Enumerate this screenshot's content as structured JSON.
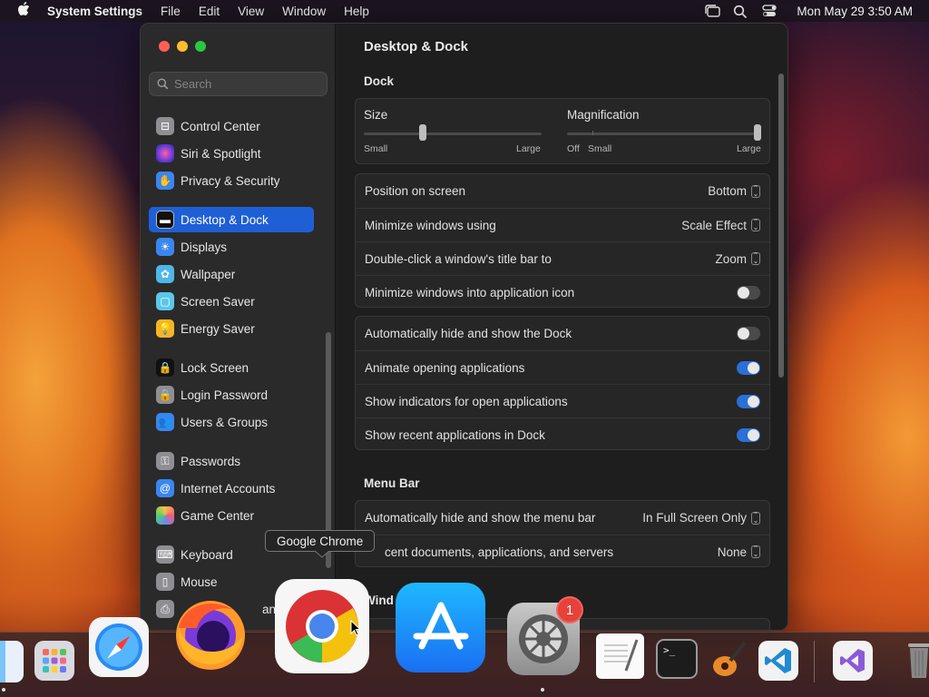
{
  "menubar": {
    "app_name": "System Settings",
    "menus": [
      "File",
      "Edit",
      "View",
      "Window",
      "Help"
    ],
    "clock": "Mon May 29  3:50 AM"
  },
  "window": {
    "title": "Desktop & Dock",
    "search_placeholder": "Search"
  },
  "sidebar": {
    "items": [
      {
        "label": "Control Center",
        "icon": "control-center-icon",
        "color": "#8e8e93"
      },
      {
        "label": "Siri & Spotlight",
        "icon": "siri-icon",
        "color": "#b03ad8"
      },
      {
        "label": "Privacy & Security",
        "icon": "hand-icon",
        "color": "#3a86f0"
      },
      {
        "label": "Desktop & Dock",
        "icon": "dock-icon",
        "color": "#1a1a1a"
      },
      {
        "label": "Displays",
        "icon": "sun-icon",
        "color": "#3a86f0"
      },
      {
        "label": "Wallpaper",
        "icon": "flower-icon",
        "color": "#4fb6e8"
      },
      {
        "label": "Screen Saver",
        "icon": "screen-saver-icon",
        "color": "#5ac8e8"
      },
      {
        "label": "Energy Saver",
        "icon": "bulb-icon",
        "color": "#f5b524"
      },
      {
        "label": "Lock Screen",
        "icon": "lock-icon",
        "color": "#1a1a1a"
      },
      {
        "label": "Login Password",
        "icon": "lock-icon",
        "color": "#8e8e93"
      },
      {
        "label": "Users & Groups",
        "icon": "users-icon",
        "color": "#3a86f0"
      },
      {
        "label": "Passwords",
        "icon": "key-icon",
        "color": "#8e8e93"
      },
      {
        "label": "Internet Accounts",
        "icon": "at-icon",
        "color": "#3a86f0"
      },
      {
        "label": "Game Center",
        "icon": "game-center-icon",
        "color": "#e8e8e8"
      },
      {
        "label": "Keyboard",
        "icon": "keyboard-icon",
        "color": "#8e8e93"
      },
      {
        "label": "Mouse",
        "icon": "mouse-icon",
        "color": "#8e8e93"
      },
      {
        "label": "anne",
        "icon": "printer-icon",
        "color": "#8e8e93"
      }
    ],
    "active_index": 3
  },
  "dock_section": {
    "title": "Dock",
    "size": {
      "label": "Size",
      "min_label": "Small",
      "max_label": "Large",
      "level": 0.33
    },
    "magnification": {
      "label": "Magnification",
      "off_label": "Off",
      "min_label": "Small",
      "max_label": "Large",
      "level": 1.0
    },
    "settings": [
      {
        "label": "Position on screen",
        "value": "Bottom"
      },
      {
        "label": "Minimize windows using",
        "value": "Scale Effect"
      },
      {
        "label": "Double-click a window's title bar to",
        "value": "Zoom"
      },
      {
        "label": "Minimize windows into application icon",
        "toggle": false
      }
    ],
    "toggles": [
      {
        "label": "Automatically hide and show the Dock",
        "on": false
      },
      {
        "label": "Animate opening applications",
        "on": true
      },
      {
        "label": "Show indicators for open applications",
        "on": true
      },
      {
        "label": "Show recent applications in Dock",
        "on": true
      }
    ]
  },
  "menu_bar_section": {
    "title": "Menu Bar",
    "rows": [
      {
        "label": "Automatically hide and show the menu bar",
        "value": "In Full Screen Only"
      },
      {
        "label": "cent documents, applications, and servers",
        "value": "None"
      }
    ]
  },
  "windows_section_title_partial": "Wind",
  "tooltip": "Google Chrome",
  "dock_apps": [
    {
      "name": "Finder",
      "icon": "finder-icon"
    },
    {
      "name": "Launchpad",
      "icon": "launchpad-icon"
    },
    {
      "name": "Safari",
      "icon": "safari-icon"
    },
    {
      "name": "Firefox",
      "icon": "firefox-icon"
    },
    {
      "name": "Google Chrome",
      "icon": "chrome-icon"
    },
    {
      "name": "App Store",
      "icon": "app-store-icon"
    },
    {
      "name": "System Settings",
      "icon": "system-settings-icon",
      "badge": "1"
    },
    {
      "name": "TextEdit",
      "icon": "textedit-icon"
    },
    {
      "name": "Terminal",
      "icon": "terminal-icon"
    },
    {
      "name": "GarageBand",
      "icon": "garageband-icon"
    },
    {
      "name": "Visual Studio Code",
      "icon": "vscode-icon"
    },
    {
      "name": "Visual Studio",
      "icon": "visual-studio-icon"
    },
    {
      "name": "Trash",
      "icon": "trash-icon"
    }
  ]
}
